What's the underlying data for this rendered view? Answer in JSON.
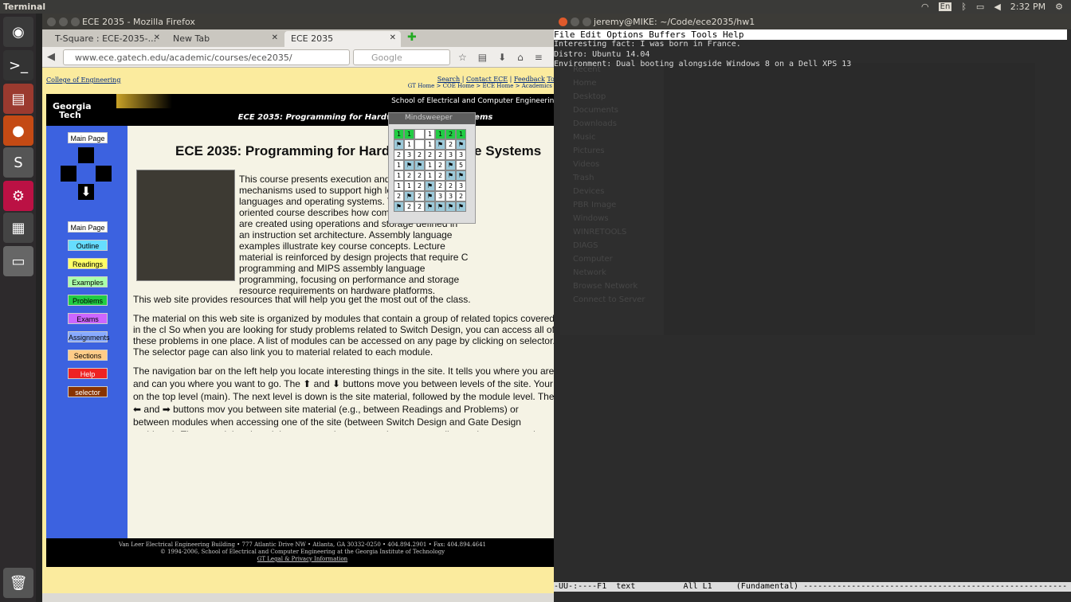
{
  "topbar": {
    "title": "Terminal",
    "lang": "En",
    "time": "2:32 PM"
  },
  "launcher": {
    "items": [
      "dash-icon",
      "terminal-icon",
      "files-icon",
      "firefox-icon",
      "sublime-icon",
      "settings-icon",
      "workspace-icon",
      "drive-icon",
      "trash-icon"
    ]
  },
  "firefox": {
    "window_title": "ECE 2035 - Mozilla Firefox",
    "tabs": [
      {
        "label": "T-Square : ECE-2035-..."
      },
      {
        "label": "New Tab"
      },
      {
        "label": "ECE 2035"
      }
    ],
    "url": "www.ece.gatech.edu/academic/courses/ece2035/",
    "search_engine_placeholder": "Google",
    "page": {
      "college_link": "College of Engineering",
      "top_links": [
        "Search",
        "Contact ECE",
        "Feedback"
      ],
      "crumbs": [
        "GT Home",
        "COE Home",
        "ECE Home",
        "Academics"
      ],
      "top_label": "Top",
      "logo_line1": "Georgia",
      "logo_line2": "Tech",
      "school": "School of Electrical and Computer Engineering",
      "course_bar": "ECE 2035: Programming for Hardware/Software Systems",
      "heading": "ECE 2035: Programming for Hardware/Software Systems",
      "main_page_top": "Main Page",
      "nav": [
        {
          "label": "Main Page",
          "bg": "#ffffff",
          "fg": "#000000"
        },
        {
          "label": "Outline",
          "bg": "#66ddff",
          "fg": "#000000"
        },
        {
          "label": "Readings",
          "bg": "#ffff66",
          "fg": "#000000"
        },
        {
          "label": "Examples",
          "bg": "#aaffaa",
          "fg": "#000000"
        },
        {
          "label": "Problems",
          "bg": "#22cc44",
          "fg": "#000000"
        },
        {
          "label": "Exams",
          "bg": "#cc66ff",
          "fg": "#000000"
        },
        {
          "label": "Assignments",
          "bg": "#88aaff",
          "fg": "#000000"
        },
        {
          "label": "Sections",
          "bg": "#ffcc88",
          "fg": "#000000"
        },
        {
          "label": "Help",
          "bg": "#ee2222",
          "fg": "#ffffff"
        },
        {
          "label": "selector",
          "bg": "#883300",
          "fg": "#ffffff"
        }
      ],
      "intro": "This course presents execution and storage mechanisms used to support high level programming languages and operating systems. This design-oriented course describes how complex mechanisms are created using operations and storage defined in an instruction set architecture. Assembly language examples illustrate key course concepts. Lecture material is reinforced by design projects that require C programming and MIPS assembly language programming, focusing on performance and storage resource requirements on hardware platforms.",
      "p1": "This web site provides resources that will help you get the most out of the class.",
      "p2": "The material on this web site is organized by modules that contain a group of related topics covered in the cl So when you are looking for study problems related to Switch Design, you can access all of these problems in one place. A list of modules can be accessed on any page by clicking on selector. The selector page can also link you to material related to each module.",
      "p3": "The navigation bar on the left help you locate interesting things in the site. It tells you where you are and can you where you want to go. The ⬆ and ⬇ buttons move you between levels of the site. Your on the top level (main). The next level is down is the site material, followed by the module level. The ⬅ and ➡ buttons mov you between site material (e.g., between Readings and Problems) or between modules when accessing one of the site (between Switch Design and Gate Design problems). The material and module names at the top p navigator pane tell you where you are in the site.",
      "footer_line1": "Van Leer Electrical Engineering Building • 777 Atlantic Drive NW • Atlanta, GA 30332-0250 • 404.894.2901 • Fax: 404.894.4641",
      "footer_line2": "© 1994-2006, School of Electrical and Computer Engineering at the Georgia Institute of Technology",
      "footer_line3": "GT Legal & Privacy Information"
    },
    "minesweeper": {
      "title": "Mindsweeper",
      "rows": [
        [
          "1",
          "1",
          "",
          "1",
          "1",
          "2",
          "1"
        ],
        [
          "⚑",
          "1",
          "",
          "1",
          "⚑",
          "2",
          "⚑"
        ],
        [
          "2",
          "3",
          "2",
          "2",
          "2",
          "3",
          "3"
        ],
        [
          "1",
          "⚑",
          "⚑",
          "1",
          "2",
          "⚑",
          "5"
        ],
        [
          "1",
          "2",
          "2",
          "1",
          "2",
          "⚑",
          "⚑"
        ],
        [
          "1",
          "1",
          "2",
          "⚑",
          "2",
          "2",
          "3"
        ],
        [
          "2",
          "⚑",
          "2",
          "⚑",
          "3",
          "3",
          "2"
        ],
        [
          "⚑",
          "2",
          "2",
          "⚑",
          "⚑",
          "⚑",
          "⚑"
        ]
      ]
    }
  },
  "terminal": {
    "window_title": "jeremy@MIKE: ~/Code/ece2035/hw1",
    "menu": [
      "File",
      "Edit",
      "Options",
      "Buffers",
      "Tools",
      "Help"
    ],
    "lines": [
      "Interesting fact: I was born in France.",
      "Distro: Ubuntu 14.04",
      "Environment: Dual booting alongside Windows 8 on a Dell XPS 13"
    ],
    "modeline": "-UU-:----F1  text          All L1     (Fundamental) -------------------------------------------------------",
    "faded_sidebar": [
      "Recent",
      "Home",
      "Desktop",
      "Documents",
      "Downloads",
      "Music",
      "Pictures",
      "Videos",
      "Trash",
      "Devices",
      "PBR Image",
      "Windows",
      "WINRETOOLS",
      "DIAGS",
      "Computer",
      "Network",
      "Browse Network",
      "Connect to Server"
    ]
  }
}
